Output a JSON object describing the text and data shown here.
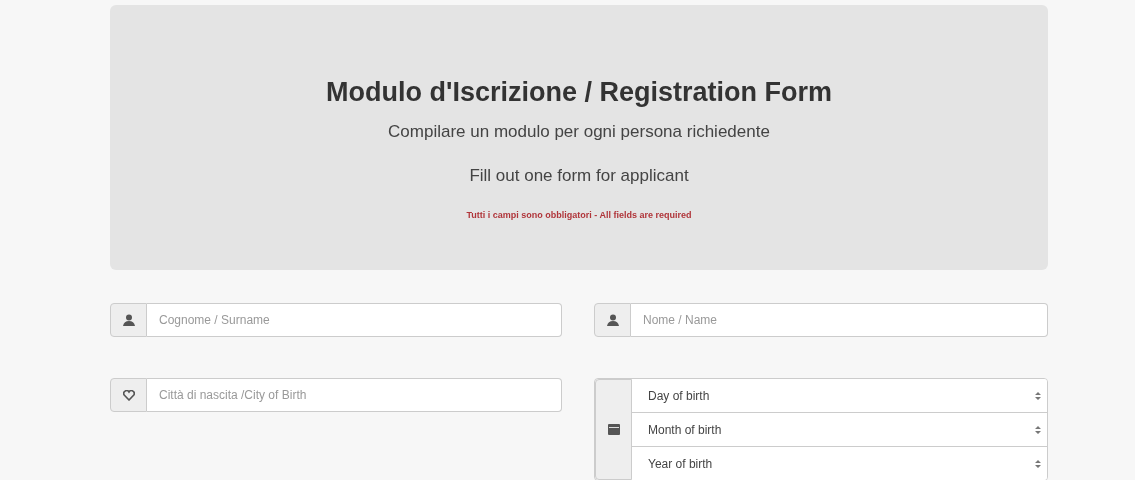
{
  "header": {
    "title": "Modulo d'Iscrizione / Registration Form",
    "subtitle": "Compilare un modulo per ogni persona richiedente",
    "instruction": "Fill out one form for applicant",
    "required_note": "Tutti i campi sono obbligatori - All fields are required"
  },
  "fields": [
    {
      "kind": "person",
      "placeholder": "Cognome / Surname"
    },
    {
      "kind": "person",
      "placeholder": "Nome / Name"
    },
    {
      "kind": "heart",
      "placeholder": "Città di nascita /City of Birth"
    }
  ],
  "birth_date": {
    "selects": [
      {
        "value": "Day of birth"
      },
      {
        "value": "Month of birth"
      },
      {
        "value": "Year of birth"
      }
    ]
  }
}
